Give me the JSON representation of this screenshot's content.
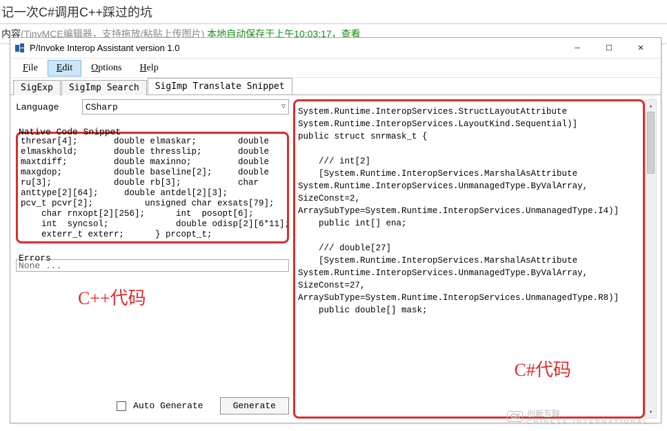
{
  "page": {
    "title": "记一次C#调用C++踩过的坑",
    "content_label": "内容",
    "content_sub": "(TinyMCE编辑器，支持拖放/粘贴上传图片)  ",
    "autosave": "本地自动保存于上午10:03:17，",
    "view_link": "查看"
  },
  "window": {
    "title": "P/Invoke Interop Assistant version 1.0",
    "menu": {
      "file": "File",
      "edit": "Edit",
      "options": "Options",
      "help": "Help"
    },
    "tabs": {
      "t1": "SigExp",
      "t2": "SigImp Search",
      "t3": "SigImp Translate Snippet"
    },
    "language_label": "Language",
    "language_value": "CSharp",
    "native_label": "Native Code Snippet",
    "native_code": "thresar[4];       double elmaskar;        double\nelmaskhold;       double thresslip;       double\nmaxtdiff;         double maxinno;         double\nmaxgdop;          double baseline[2];     double\nru[3];            double rb[3];           char\nanttype[2][64];     double antdel[2][3];\npcv_t pcvr[2];          unsigned char exsats[79];\n    char rnxopt[2][256];      int  posopt[6];\n    int  syncsol;             double odisp[2][6*11];\n    exterr_t exterr;      } prcopt_t;",
    "errors_label": "Errors",
    "errors_value": "None ...",
    "auto_generate_label": "Auto Generate",
    "generate_label": "Generate",
    "output_code": "System.Runtime.InteropServices.StructLayoutAttribute\nSystem.Runtime.InteropServices.LayoutKind.Sequential)]\npublic struct snrmask_t {\n\n    /// int[2]\n    [System.Runtime.InteropServices.MarshalAsAttribute\nSystem.Runtime.InteropServices.UnmanagedType.ByValArray,\nSizeConst=2,\nArraySubType=System.Runtime.InteropServices.UnmanagedType.I4)]\n    public int[] ena;\n\n    /// double[27]\n    [System.Runtime.InteropServices.MarshalAsAttribute\nSystem.Runtime.InteropServices.UnmanagedType.ByValArray,\nSizeConst=27,\nArraySubType=System.Runtime.InteropServices.UnmanagedType.R8)]\n    public double[] mask;"
  },
  "annotations": {
    "cpp": "C++代码",
    "cs": "C#代码"
  },
  "watermark": {
    "logo": "CX",
    "en": "CHINESE INTERNATIONAL",
    "cn": "创新互联"
  }
}
